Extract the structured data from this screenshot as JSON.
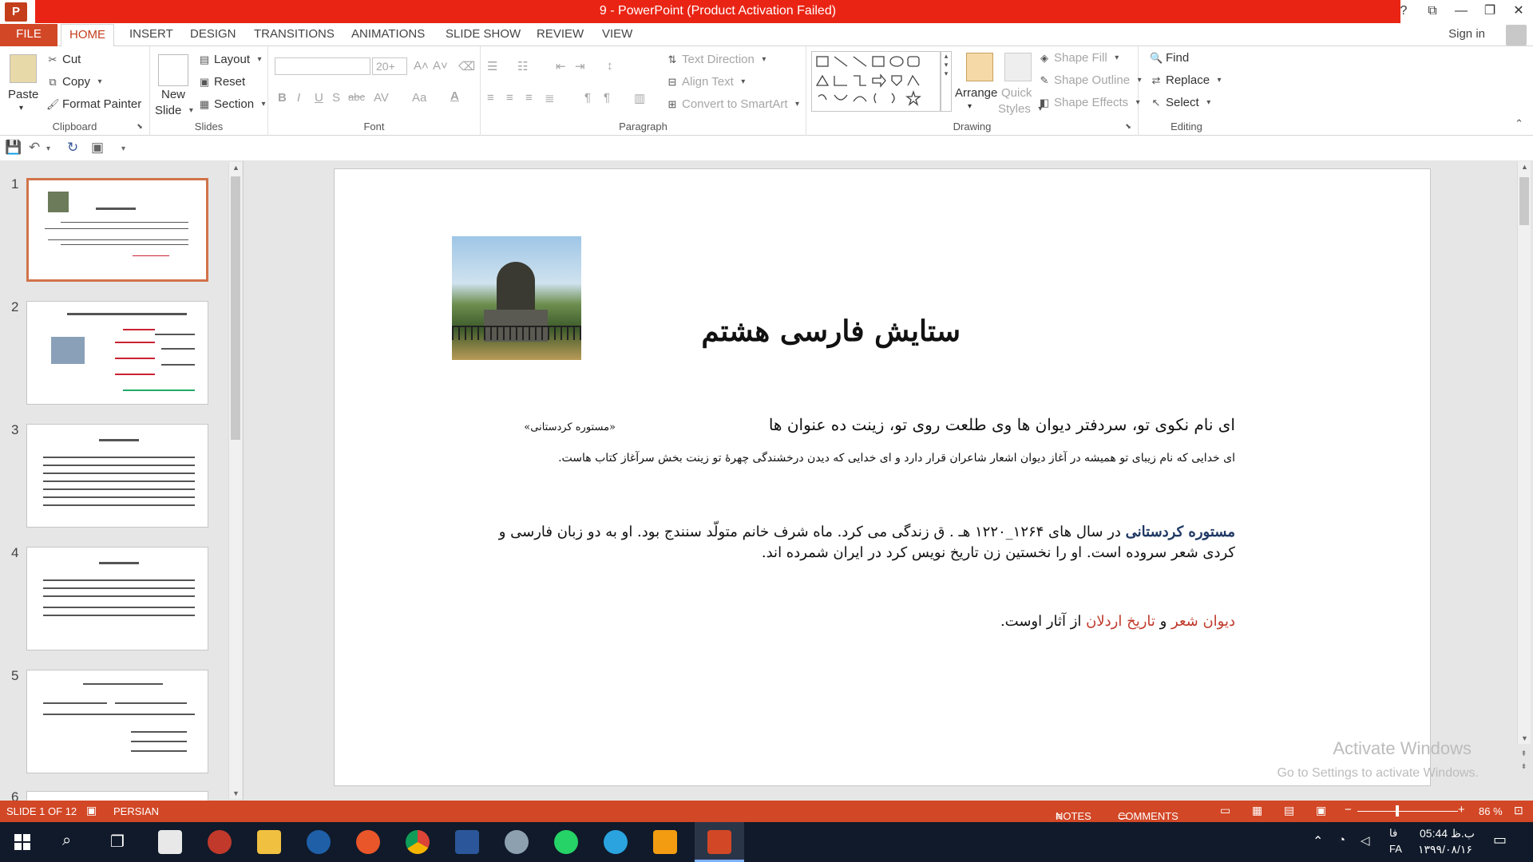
{
  "window": {
    "title": "9 -  PowerPoint (Product Activation Failed)",
    "app_logo": "P",
    "help": "?",
    "ribbon_options": "⧉",
    "minimize": "—",
    "restore": "❐",
    "close": "✕"
  },
  "tabs": [
    "FILE",
    "HOME",
    "INSERT",
    "DESIGN",
    "TRANSITIONS",
    "ANIMATIONS",
    "SLIDE SHOW",
    "REVIEW",
    "VIEW"
  ],
  "account": {
    "sign_in": "Sign in"
  },
  "ribbon": {
    "clipboard": {
      "label": "Clipboard",
      "paste": "Paste",
      "cut": "Cut",
      "copy": "Copy",
      "format_painter": "Format Painter"
    },
    "slides": {
      "label": "Slides",
      "new_slide_line1": "New",
      "new_slide_line2": "Slide",
      "layout": "Layout",
      "reset": "Reset",
      "section": "Section"
    },
    "font": {
      "label": "Font",
      "font_size": "20+",
      "bold": "B",
      "italic": "I",
      "underline": "U",
      "shadow": "S",
      "strike": "abc",
      "spacing": "AV",
      "case": "Aa",
      "color": "A"
    },
    "paragraph": {
      "label": "Paragraph",
      "text_direction": "Text Direction",
      "align_text": "Align Text",
      "convert_smartart": "Convert to SmartArt"
    },
    "drawing": {
      "label": "Drawing",
      "arrange": "Arrange",
      "quick_styles_line1": "Quick",
      "quick_styles_line2": "Styles",
      "shape_fill": "Shape Fill",
      "shape_outline": "Shape Outline",
      "shape_effects": "Shape Effects"
    },
    "editing": {
      "label": "Editing",
      "find": "Find",
      "replace": "Replace",
      "select": "Select"
    }
  },
  "slides": [
    {
      "number": "1",
      "selected": true
    },
    {
      "number": "2",
      "selected": false
    },
    {
      "number": "3",
      "selected": false
    },
    {
      "number": "4",
      "selected": false
    },
    {
      "number": "5",
      "selected": false
    },
    {
      "number": "6",
      "selected": false
    }
  ],
  "slide": {
    "title": "ستایش   فارسی هشتم",
    "verse": "ای نام نکوی تو، سردفتر دیوان ها          وی طلعت روی تو، زینت ده عنوان ها",
    "verse_attribution": "«مستوره کردستانی»",
    "verse_meaning": "ای خدایی که نام زیبای تو همیشه در آغاز دیوان اشعار شاعران قرار دارد و ای خدایی که دیدن درخشندگی چهرۀ تو زینت بخش سرآغاز کتاب هاست.",
    "bio_name": "مستوره کردستانی",
    "bio_line1_rest": " در سال های ۱۲۶۴_۱۲۲۰ هـ . ق زندگی می کرد. ماه شرف خانم متولّد سنندج بود. او به  دو زبان فارسی و",
    "bio_line2": "کردی شعر سروده است. او را نخستین زن تاریخ نویس کرد در ایران شمرده اند.",
    "works_1": "دیوان شعر",
    "works_and": " و ",
    "works_2": "تاریخ اردلان",
    "works_rest": " از آثار اوست."
  },
  "watermark": {
    "line1": "Activate Windows",
    "line2": "Go to Settings to activate Windows."
  },
  "status": {
    "slide_info": "SLIDE 1 OF 12",
    "language": "PERSIAN",
    "notes": "NOTES",
    "comments": "COMMENTS",
    "zoom_minus": "−",
    "zoom_plus": "+",
    "zoom": "86 %"
  },
  "taskbar": {
    "time": "05:44 ب.ظ",
    "date": "۱۳۹۹/۰۸/۱۶",
    "lang_top": "فا",
    "lang_bottom": "FA"
  },
  "colors": {
    "accent": "#d24726",
    "title_red": "#ea2414",
    "bio_blue": "#1f3864",
    "works_red": "#c0392b"
  }
}
